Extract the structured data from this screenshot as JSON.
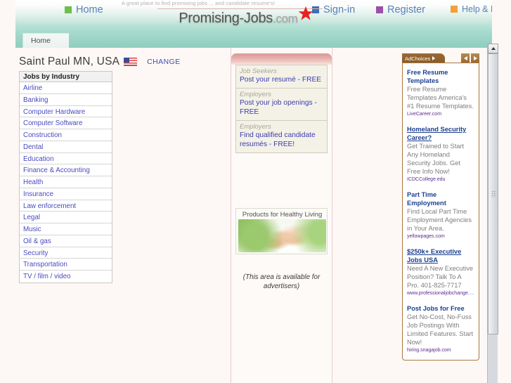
{
  "header": {
    "tagline": "A great place to find promising jobs ... and candidate resume's!",
    "logo_name": "Promising-Jobs",
    "logo_tld": ".com",
    "nav": [
      {
        "label": "Home",
        "color": "#6cbf4a",
        "name": "nav-home"
      },
      {
        "label": "Sign-in",
        "color": "#3f6fb5",
        "name": "nav-signin"
      },
      {
        "label": "Register",
        "color": "#9c4fa8",
        "name": "nav-register"
      },
      {
        "label": "Help & FAQ",
        "color": "#f2a03c",
        "name": "nav-help"
      }
    ],
    "star_icon": "star-icon"
  },
  "tabbar": {
    "tabs": [
      {
        "label": "Home",
        "active": true
      }
    ]
  },
  "location": {
    "name": "Saint Paul MN, USA",
    "flag_icon": "us-flag-icon",
    "change_label": "CHANGE"
  },
  "industry": {
    "heading": "Jobs by Industry",
    "items": [
      "Airline",
      "Banking",
      "Computer Hardware",
      "Computer Software",
      "Construction",
      "Dental",
      "Education",
      "Finance & Accounting",
      "Health",
      "Insurance",
      "Law enforcement",
      "Legal",
      "Music",
      "Oil & gas",
      "Security",
      "Transportation",
      "TV / film / video"
    ]
  },
  "center": {
    "promos": [
      {
        "kicker": "Job Seekers",
        "text": "Post your resumé - FREE"
      },
      {
        "kicker": "Employers",
        "text": "Post your job openings - FREE"
      },
      {
        "kicker": "Employers",
        "text": "Find qualified candidate resumés - FREE!"
      }
    ],
    "healthy_living_title": "Products for Healthy Living",
    "advertiser_note": "(This area is available for advertisers)"
  },
  "ads": {
    "label": "AdChoices",
    "prev_label": "previous",
    "next_label": "next",
    "items": [
      {
        "title": "Free Resume Templates",
        "underlined": false,
        "desc": "Free Resume Templates America's #1 Resume Templates.",
        "url": "LiveCareer.com"
      },
      {
        "title": "Homeland Security Career?",
        "underlined": true,
        "desc": "Get Trained to Start Any Homeland Security Jobs. Get Free Info Now!",
        "url": "ICDCCollege.edu"
      },
      {
        "title": "Part Time Employment",
        "underlined": false,
        "desc": "Find Local Part Time Employment Agencies in Your Area.",
        "url": "yellowpages.com"
      },
      {
        "title": "$250k+ Executive Jobs USA",
        "underlined": true,
        "desc": "Need A New Executive Position? Talk To A Pro. 401-825-7717",
        "url": "www.professionaljobchange.c..."
      },
      {
        "title": "Post Jobs for Free",
        "underlined": false,
        "desc": "Get No-Cost, No-Fuss Job Postings With Limited Features. Start Now!",
        "url": "hiring.snagajob.com"
      }
    ]
  },
  "scrollbar": {
    "up_label": "scroll up"
  },
  "colors": {
    "header_teal": "#a8dbcd",
    "link_blue": "#4a4ac0",
    "ad_brown": "#8a5c2a",
    "promo_pink": "#d99a95"
  }
}
